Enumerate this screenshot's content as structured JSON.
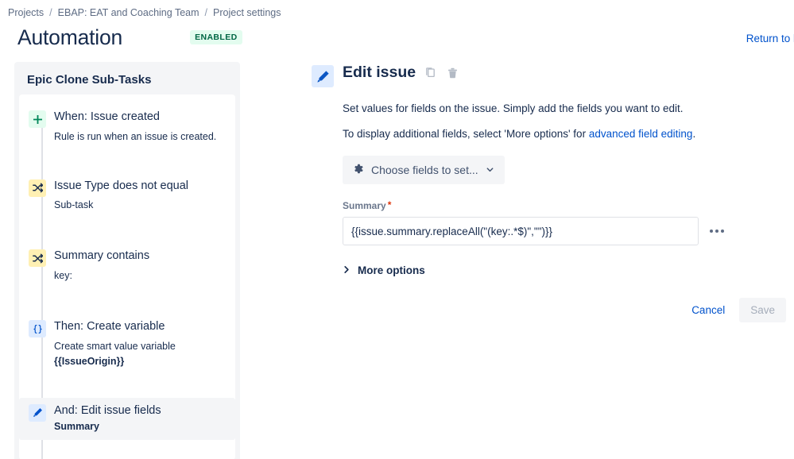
{
  "breadcrumb": {
    "items": [
      "Projects",
      "EBAP: EAT and Coaching Team",
      "Project settings"
    ],
    "separator": "/"
  },
  "header": {
    "title": "Automation",
    "status_badge": "ENABLED",
    "return_link": "Return to l",
    "badge_bg": "#E3FCEF",
    "badge_color": "#006644",
    "link_color": "#0052CC"
  },
  "rule_panel": {
    "title": "Epic Clone Sub-Tasks",
    "items": [
      {
        "icon": "plus-icon",
        "icon_type": "trigger",
        "label": "When: Issue created",
        "sub": "Rule is run when an issue is created.",
        "sub_bold": "",
        "selected": false
      },
      {
        "icon": "shuffle-icon",
        "icon_type": "condition",
        "label": "Issue Type does not equal",
        "sub": "Sub-task",
        "sub_bold": "",
        "selected": false
      },
      {
        "icon": "shuffle-icon",
        "icon_type": "condition",
        "label": "Summary contains",
        "sub": "key:",
        "sub_bold": "",
        "selected": false
      },
      {
        "icon": "braces-icon",
        "icon_type": "variable",
        "label": "Then: Create variable",
        "sub": "Create smart value variable",
        "sub_bold": "{{IssueOrigin}}",
        "selected": false
      },
      {
        "icon": "pencil-icon",
        "icon_type": "action",
        "label": "And: Edit issue fields",
        "sub": "",
        "sub_bold": "Summary",
        "selected": true
      }
    ]
  },
  "detail": {
    "icon": "pencil-icon",
    "title": "Edit issue",
    "copy_icon": "copy-icon",
    "delete_icon": "trash-icon",
    "description_1": "Set values for fields on the issue. Simply add the fields you want to edit.",
    "description_2_prefix": "To display additional fields, select 'More options' for ",
    "description_2_link": "advanced field editing",
    "description_2_suffix": ".",
    "choose_fields": {
      "label": "Choose fields to set...",
      "icon": "gear-icon",
      "chevron": "chevron-down-icon"
    },
    "summary_field": {
      "label": "Summary",
      "required_marker": "*",
      "value": "{{issue.summary.replaceAll(\"(key:.*$)\",\"\")}}",
      "placeholder": "",
      "overflow_icon": "ellipsis-icon"
    },
    "more_options": {
      "label": "More options",
      "chevron": "chevron-right-icon"
    },
    "cancel_label": "Cancel",
    "save_label": "Save"
  }
}
